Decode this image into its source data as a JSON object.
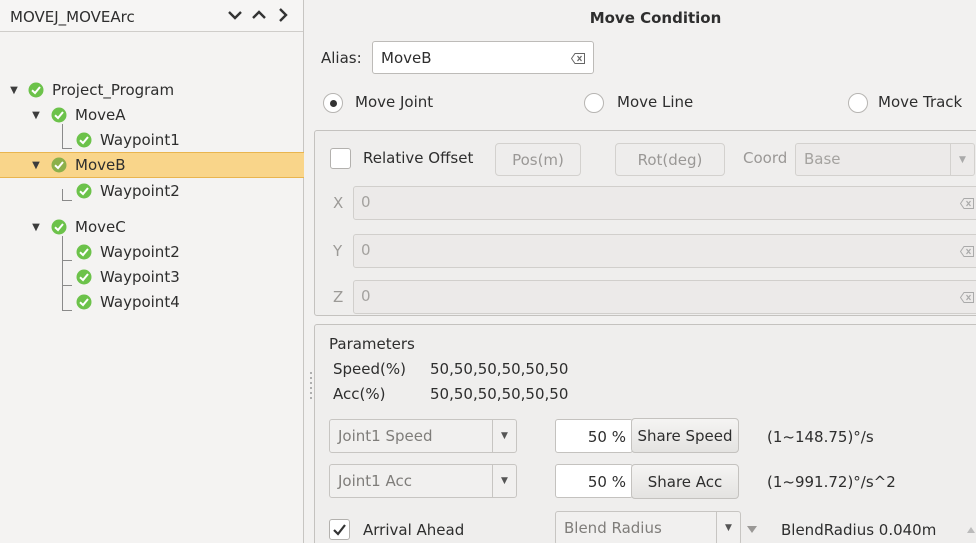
{
  "tree": {
    "header_title": "MOVEJ_MOVEArc",
    "nodes": [
      {
        "label": "Project_Program"
      },
      {
        "label": "MoveA"
      },
      {
        "label": "Waypoint1"
      },
      {
        "label": "MoveB"
      },
      {
        "label": "Waypoint2"
      },
      {
        "label": "MoveC"
      },
      {
        "label": "Waypoint2"
      },
      {
        "label": "Waypoint3"
      },
      {
        "label": "Waypoint4"
      }
    ],
    "selected": "MoveB"
  },
  "panel": {
    "title": "Move Condition",
    "alias_label": "Alias:",
    "alias_value": "MoveB",
    "radios": {
      "move_joint": "Move Joint",
      "move_line": "Move Line",
      "move_track": "Move Track",
      "selected": "Move Joint"
    },
    "offset": {
      "relative_offset_label": "Relative Offset",
      "pos_button": "Pos(m)",
      "rot_button": "Rot(deg)",
      "coord_label": "Coord",
      "coord_value": "Base",
      "x_label": "X",
      "x_value": "0",
      "y_label": "Y",
      "y_value": "0",
      "z_label": "Z",
      "z_value": "0"
    },
    "parameters": {
      "title": "Parameters",
      "speed_label": "Speed(%)",
      "speed_value": "50,50,50,50,50,50",
      "acc_label": "Acc(%)",
      "acc_value": "50,50,50,50,50,50",
      "joint_speed_select": "Joint1 Speed",
      "joint_speed_pct": "50 %",
      "share_speed_button": "Share Speed",
      "speed_range": "(1~148.75)°/s",
      "joint_acc_select": "Joint1 Acc",
      "joint_acc_pct": "50 %",
      "share_acc_button": "Share Acc",
      "acc_range": "(1~991.72)°/s^2",
      "arrival_ahead_label": "Arrival Ahead",
      "arrival_ahead_checked": true,
      "blend_select": "Blend Radius",
      "blend_radius_text": "BlendRadius 0.040m"
    }
  },
  "colors": {
    "selection": "#f9d58a",
    "check_green": "#6cc24a"
  }
}
